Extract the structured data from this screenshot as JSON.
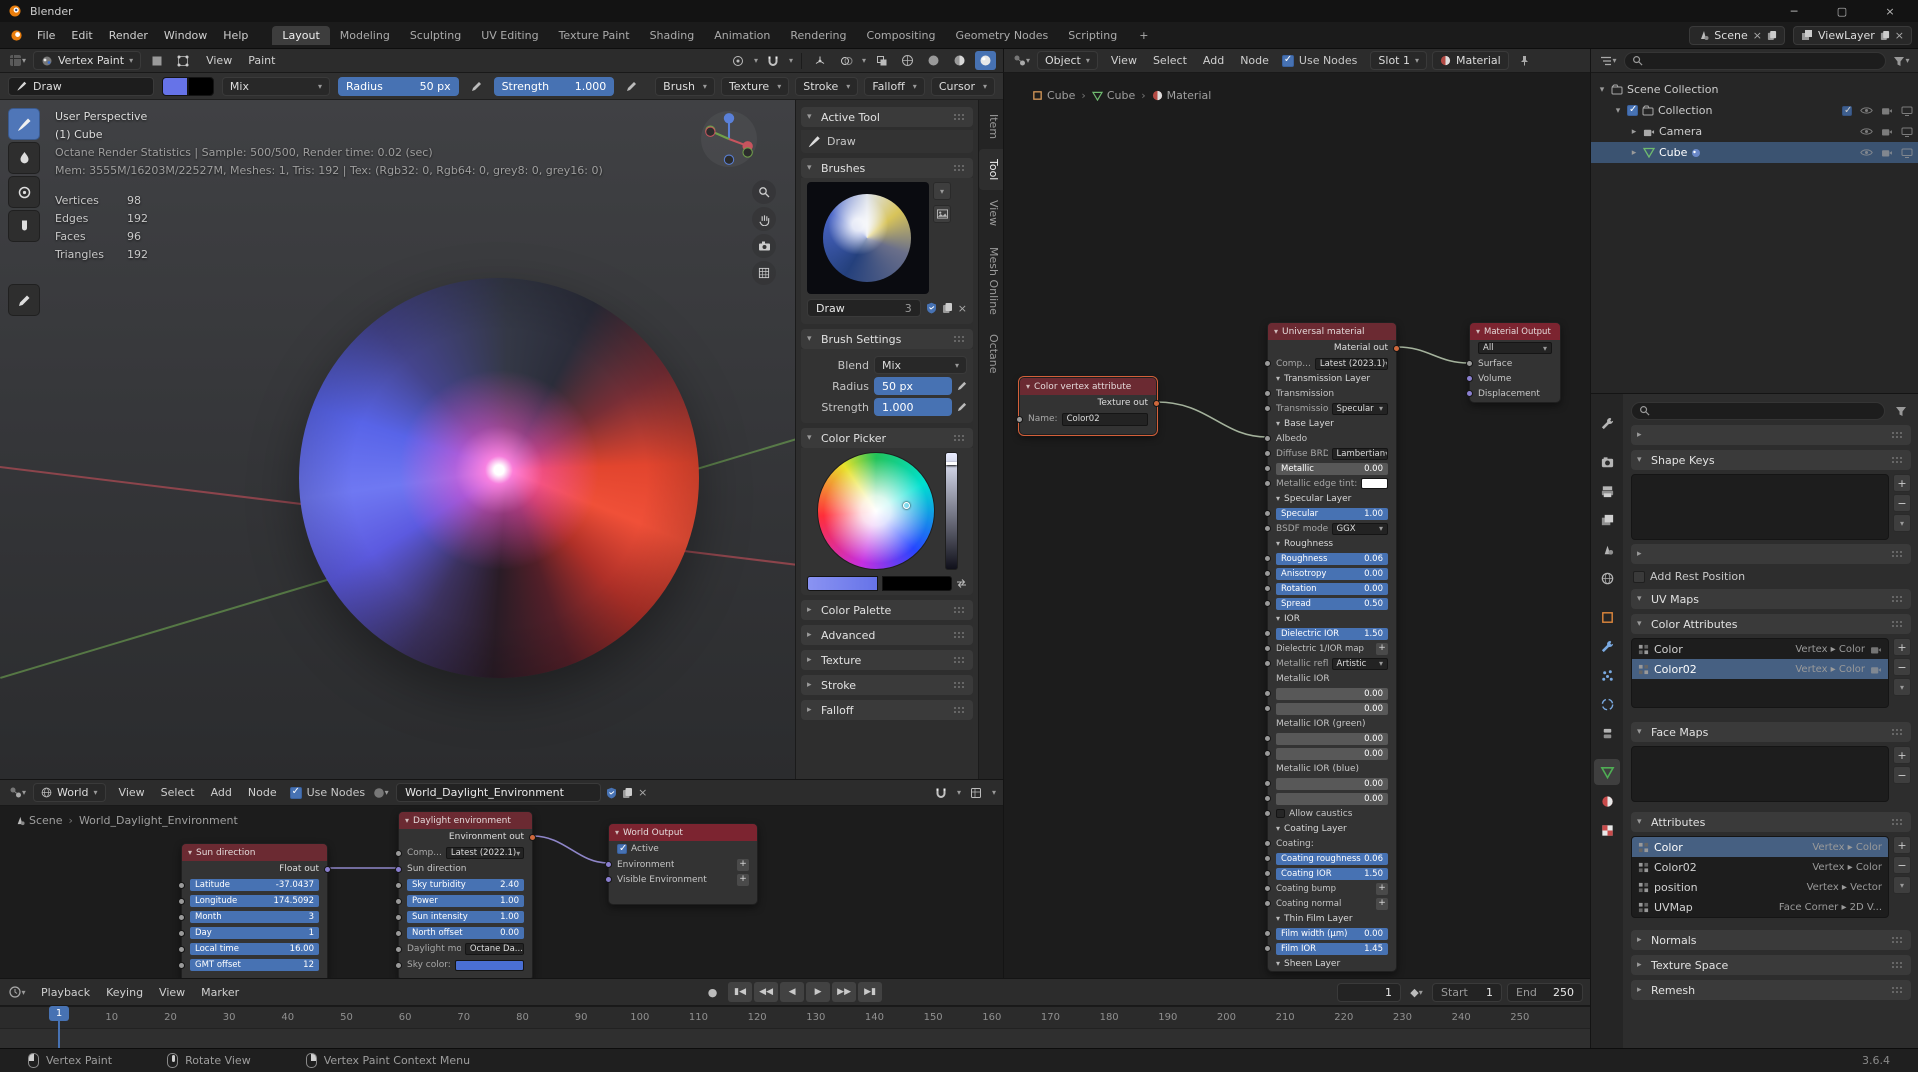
{
  "colors": {
    "accent": "#4772b3",
    "node_header": "#6b2a32",
    "selection": "#3b5371",
    "wire_shader": "#a4b29c",
    "wire_world": "#8f86c9",
    "paint_color": "#6673e8",
    "secondary_color": "#000000",
    "sky_color": "#4a6fd4"
  },
  "titlebar": {
    "app": "Blender",
    "minimize": "─",
    "maximize": "▢",
    "close": "×"
  },
  "menubar": {
    "menus": [
      "File",
      "Edit",
      "Render",
      "Window",
      "Help"
    ],
    "workspaces": [
      "Layout",
      "Modeling",
      "Sculpting",
      "UV Editing",
      "Texture Paint",
      "Shading",
      "Animation",
      "Rendering",
      "Compositing",
      "Geometry Nodes",
      "Scripting"
    ],
    "active_workspace": "Layout",
    "new_workspace_label": "+",
    "scene_selector": "Scene",
    "viewlayer_selector": "ViewLayer"
  },
  "viewport": {
    "header": {
      "mode": "Vertex Paint",
      "menus": [
        "View",
        "Paint"
      ]
    },
    "tool_settings": {
      "tool_label": "Draw",
      "blend_mode": "Mix",
      "radius_label": "Radius",
      "radius_value": "50 px",
      "strength_label": "Strength",
      "strength_value": "1.000",
      "popovers": [
        "Brush",
        "Texture",
        "Stroke",
        "Falloff",
        "Cursor"
      ]
    },
    "overlay_lines": [
      "User Perspective",
      "(1) Cube",
      "Octane Render Statistics | Sample: 500/500, Render time: 0.02 (sec)",
      "Mem: 3555M/16203M/22527M, Meshes: 1, Tris: 192 | Tex: (Rgb32: 0, Rgb64: 0, grey8: 0, grey16: 0)"
    ],
    "stats": [
      {
        "label": "Vertices",
        "value": "98"
      },
      {
        "label": "Edges",
        "value": "192"
      },
      {
        "label": "Faces",
        "value": "96"
      },
      {
        "label": "Triangles",
        "value": "192"
      }
    ],
    "tools": [
      "draw",
      "blur",
      "average",
      "smear",
      "annotate"
    ]
  },
  "sidebar": {
    "tabs": [
      "Item",
      "Tool",
      "View",
      "Mesh Online",
      "Octane"
    ],
    "active_tab": "Tool",
    "active_tool_title": "Active Tool",
    "active_tool_name": "Draw",
    "brushes_title": "Brushes",
    "brush_name": "Draw",
    "brush_users": "3",
    "brush_settings_title": "Brush Settings",
    "settings": [
      {
        "label": "Blend",
        "value": "Mix",
        "type": "dropdown"
      },
      {
        "label": "Radius",
        "value": "50 px",
        "type": "slider"
      },
      {
        "label": "Strength",
        "value": "1.000",
        "type": "slider"
      }
    ],
    "color_picker_title": "Color Picker",
    "collapsed_panels": [
      "Color Palette",
      "Advanced",
      "Texture",
      "Stroke",
      "Falloff"
    ]
  },
  "shader_editor": {
    "header": {
      "shader_type": "Object",
      "menus": [
        "View",
        "Select",
        "Add",
        "Node"
      ],
      "use_nodes_label": "Use Nodes",
      "slot": "Slot 1",
      "material_name": "Material"
    },
    "breadcrumb": [
      "Cube",
      "Cube",
      "Material"
    ],
    "vertex_attr_node": {
      "title": "Color vertex attribute",
      "output_label": "Texture out",
      "name_label": "Name:",
      "name_value": "Color02"
    },
    "universal_node": {
      "title": "Universal material",
      "output_label": "Material out",
      "rows": [
        {
          "t": "dd",
          "label": "Comp...",
          "value": "Latest (2023.1)"
        },
        {
          "t": "sec",
          "label": "Transmission Layer"
        },
        {
          "t": "sock",
          "label": "Transmission"
        },
        {
          "t": "dd",
          "label": "Transmission t...",
          "value": "Specular"
        },
        {
          "t": "sec",
          "label": "Base Layer"
        },
        {
          "t": "sock",
          "label": "Albedo"
        },
        {
          "t": "dd",
          "label": "Diffuse BRDF ...",
          "value": "Lambertian"
        },
        {
          "t": "gray",
          "label": "Metallic",
          "value": "0.00"
        },
        {
          "t": "color",
          "label": "Metallic edge tint:",
          "value": "#ffffff"
        },
        {
          "t": "sec",
          "label": "Specular Layer"
        },
        {
          "t": "blue",
          "label": "Specular",
          "value": "1.00"
        },
        {
          "t": "dd",
          "label": "BSDF model",
          "value": "GGX"
        },
        {
          "t": "sec",
          "label": "Roughness"
        },
        {
          "t": "blue",
          "label": "Roughness",
          "value": "0.06"
        },
        {
          "t": "blue",
          "label": "Anisotropy",
          "value": "0.00"
        },
        {
          "t": "blue",
          "label": "Rotation",
          "value": "0.00"
        },
        {
          "t": "blue",
          "label": "Spread",
          "value": "0.50"
        },
        {
          "t": "sec",
          "label": "IOR"
        },
        {
          "t": "blue",
          "label": "Dielectric IOR",
          "value": "1.50"
        },
        {
          "t": "plus",
          "label": "Dielectric 1/IOR map"
        },
        {
          "t": "dd",
          "label": "Metallic reflect...",
          "value": "Artistic"
        },
        {
          "t": "lbl",
          "label": "Metallic IOR"
        },
        {
          "t": "val",
          "value": "0.00"
        },
        {
          "t": "val",
          "value": "0.00"
        },
        {
          "t": "lbl",
          "label": "Metallic IOR (green)"
        },
        {
          "t": "val",
          "value": "0.00"
        },
        {
          "t": "val",
          "value": "0.00"
        },
        {
          "t": "lbl",
          "label": "Metallic IOR (blue)"
        },
        {
          "t": "val",
          "value": "0.00"
        },
        {
          "t": "val",
          "value": "0.00"
        },
        {
          "t": "chk",
          "label": "Allow caustics"
        },
        {
          "t": "sec",
          "label": "Coating Layer"
        },
        {
          "t": "sock",
          "label": "Coating:"
        },
        {
          "t": "blue",
          "label": "Coating roughness",
          "value": "0.06"
        },
        {
          "t": "blue",
          "label": "Coating IOR",
          "value": "1.50"
        },
        {
          "t": "plus",
          "label": "Coating bump"
        },
        {
          "t": "plus",
          "label": "Coating normal"
        },
        {
          "t": "sec",
          "label": "Thin Film Layer"
        },
        {
          "t": "blue",
          "label": "Film width (μm)",
          "value": "0.00"
        },
        {
          "t": "blue",
          "label": "Film IOR",
          "value": "1.45"
        },
        {
          "t": "sec",
          "label": "Sheen Layer"
        }
      ]
    },
    "material_output_node": {
      "title": "Material Output",
      "target_value": "All",
      "inputs": [
        "Surface",
        "Volume",
        "Displacement"
      ]
    }
  },
  "world_editor": {
    "header": {
      "shader_type": "World",
      "menus": [
        "View",
        "Select",
        "Add",
        "Node"
      ],
      "use_nodes_label": "Use Nodes",
      "world_name": "World_Daylight_Environment"
    },
    "breadcrumb": [
      "Scene",
      "World_Daylight_Environment"
    ],
    "sun_node": {
      "title": "Sun direction",
      "output_label": "Float out",
      "rows": [
        {
          "t": "blue",
          "label": "Latitude",
          "value": "-37.0437"
        },
        {
          "t": "blue",
          "label": "Longitude",
          "value": "174.5092"
        },
        {
          "t": "blue",
          "label": "Month",
          "value": "3"
        },
        {
          "t": "blue",
          "label": "Day",
          "value": "1"
        },
        {
          "t": "blue",
          "label": "Local time",
          "value": "16.00"
        },
        {
          "t": "blue",
          "label": "GMT offset",
          "value": "12"
        }
      ]
    },
    "daylight_node": {
      "title": "Daylight environment",
      "output_label": "Environment out",
      "rows": [
        {
          "t": "dd",
          "label": "Comp...",
          "value": "Latest (2022.1)"
        },
        {
          "t": "sock",
          "label": "Sun direction"
        },
        {
          "t": "blue",
          "label": "Sky turbidity",
          "value": "2.40"
        },
        {
          "t": "blue",
          "label": "Power",
          "value": "1.00"
        },
        {
          "t": "blue",
          "label": "Sun intensity",
          "value": "1.00"
        },
        {
          "t": "blue",
          "label": "North offset",
          "value": "0.00"
        },
        {
          "t": "dd",
          "label": "Daylight model",
          "value": "Octane Da..."
        },
        {
          "t": "color",
          "label": "Sky color:",
          "value": "#4a6fd4"
        }
      ]
    },
    "world_output_node": {
      "title": "World Output",
      "active_label": "Active",
      "inputs": [
        "Environment",
        "Visible Environment"
      ]
    }
  },
  "outliner": {
    "rows": [
      {
        "name": "Scene Collection",
        "depth": 0,
        "icon": "collection",
        "tri": "▾",
        "right": []
      },
      {
        "name": "Collection",
        "depth": 1,
        "icon": "collection",
        "tri": "▾",
        "checkbox": true,
        "right": [
          "check",
          "eye",
          "camera",
          "screen"
        ]
      },
      {
        "name": "Camera",
        "depth": 2,
        "icon": "camera",
        "tri": "▸",
        "right": [
          "eye",
          "camera",
          "screen"
        ]
      },
      {
        "name": "Cube",
        "depth": 2,
        "icon": "mesh",
        "tri": "▸",
        "selected": true,
        "mode_dot": true,
        "right": [
          "eye",
          "camera",
          "screen"
        ]
      }
    ]
  },
  "properties": {
    "tabs": [
      "tool",
      "render",
      "output",
      "view-layer",
      "scene",
      "world",
      "object",
      "modifiers",
      "particles",
      "physics",
      "constraints",
      "object-data",
      "material",
      "texture"
    ],
    "active_tab": "object-data",
    "shape_keys_title": "Shape Keys",
    "add_rest_position_label": "Add Rest Position",
    "uv_maps_title": "UV Maps",
    "color_attributes": {
      "title": "Color Attributes",
      "items": [
        {
          "name": "Color",
          "domain": "Vertex",
          "dtype": "Color",
          "selected": false
        },
        {
          "name": "Color02",
          "domain": "Vertex",
          "dtype": "Color",
          "selected": true
        }
      ]
    },
    "face_maps_title": "Face Maps",
    "attributes": {
      "title": "Attributes",
      "items": [
        {
          "name": "Color",
          "domain": "Vertex",
          "dtype": "Color",
          "selected": true
        },
        {
          "name": "Color02",
          "domain": "Vertex",
          "dtype": "Color",
          "selected": false
        },
        {
          "name": "position",
          "domain": "Vertex",
          "dtype": "Vector",
          "selected": false
        },
        {
          "name": "UVMap",
          "domain": "Face Corner",
          "dtype": "2D V...",
          "selected": false
        }
      ]
    },
    "collapsed_panels": [
      "Normals",
      "Texture Space",
      "Remesh"
    ]
  },
  "timeline": {
    "menus": [
      "Playback",
      "Keying",
      "View",
      "Marker"
    ],
    "current_frame": "1",
    "start_label": "Start",
    "start_value": "1",
    "end_label": "End",
    "end_value": "250",
    "ticks": [
      10,
      20,
      30,
      40,
      50,
      60,
      70,
      80,
      90,
      100,
      110,
      120,
      130,
      140,
      150,
      160,
      170,
      180,
      190,
      200,
      210,
      220,
      230,
      240,
      250
    ]
  },
  "statusbar": {
    "items": [
      {
        "button": "left",
        "label": "Vertex Paint"
      },
      {
        "button": "middle",
        "label": "Rotate View"
      },
      {
        "button": "right",
        "label": "Vertex Paint Context Menu"
      }
    ],
    "version": "3.6.4"
  }
}
